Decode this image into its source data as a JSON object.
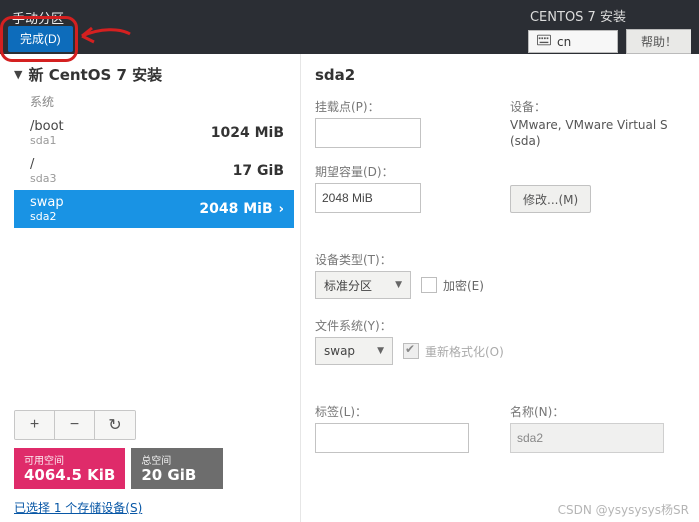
{
  "top": {
    "title": "手动分区",
    "done_label": "完成(D)",
    "install_label": "CENTOS 7 安装",
    "lang": "cn",
    "help_label": "帮助！"
  },
  "left": {
    "tree_title": "新 CentOS 7 安装",
    "system_label": "系统",
    "partitions": [
      {
        "mount": "/boot",
        "dev": "sda1",
        "size": "1024 MiB",
        "selected": false
      },
      {
        "mount": "/",
        "dev": "sda3",
        "size": "17 GiB",
        "selected": false
      },
      {
        "mount": "swap",
        "dev": "sda2",
        "size": "2048 MiB",
        "selected": true
      }
    ],
    "buttons": {
      "add": "+",
      "remove": "−",
      "reload": "↻"
    },
    "space_available_label": "可用空间",
    "space_available_value": "4064.5 KiB",
    "space_total_label": "总空间",
    "space_total_value": "20 GiB",
    "storage_link": "已选择 1 个存储设备(S)"
  },
  "right": {
    "heading": "sda2",
    "mount_label": "挂载点(P)：",
    "mount_value": "",
    "device_label": "设备：",
    "device_value": "VMware, VMware Virtual S (sda)",
    "capacity_label": "期望容量(D)：",
    "capacity_value": "2048 MiB",
    "modify_label": "修改...(M)",
    "devtype_label": "设备类型(T)：",
    "devtype_value": "标准分区",
    "encrypt_label": "加密(E)",
    "fs_label": "文件系统(Y)：",
    "fs_value": "swap",
    "reformat_label": "重新格式化(O)",
    "tag_label": "标签(L)：",
    "tag_value": "",
    "name_label": "名称(N)：",
    "name_value": "sda2"
  },
  "watermark": "CSDN @ysysysys杨SR"
}
